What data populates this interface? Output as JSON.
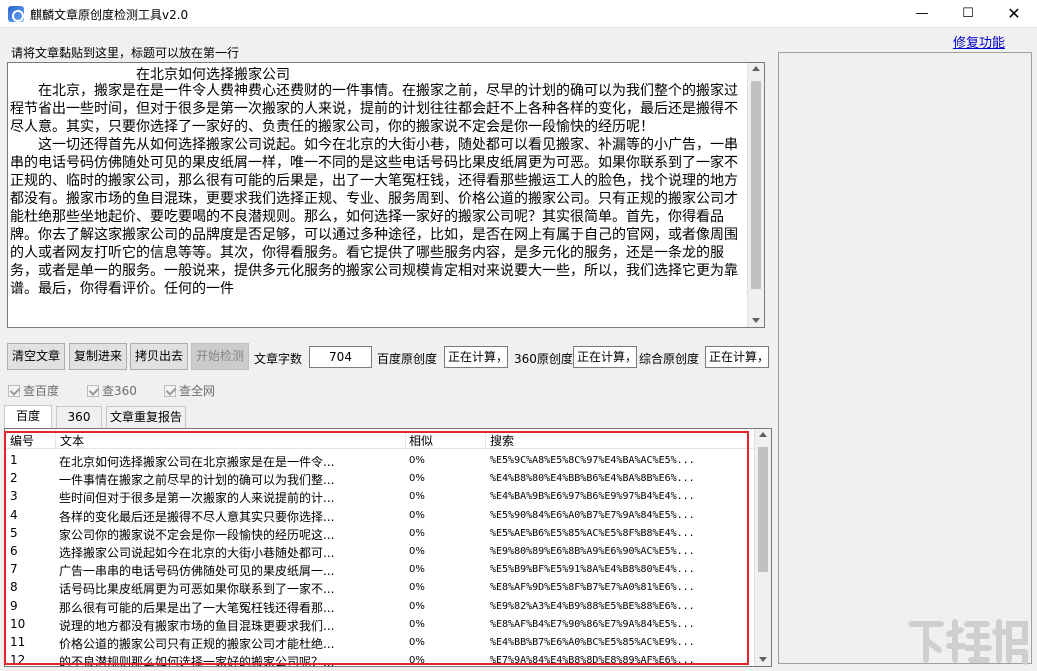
{
  "window": {
    "title": "麒麟文章原创度检测工具v2.0",
    "minimize": "—",
    "maximize": "☐",
    "close": "✕"
  },
  "header": {
    "repair_link": "修复功能"
  },
  "prompt": "请将文章黏贴到这里，标题可以放在第一行",
  "article": {
    "title": "在北京如何选择搬家公司",
    "body": "　　在北京，搬家是在是一件令人费神费心还费财的一件事情。在搬家之前，尽早的计划的确可以为我们整个的搬家过程节省出一些时间，但对于很多是第一次搬家的人来说，提前的计划往往都会赶不上各种各样的变化，最后还是搬得不尽人意。其实，只要你选择了一家好的、负责任的搬家公司，你的搬家说不定会是你一段愉快的经历呢！\n　　这一切还得首先从如何选择搬家公司说起。如今在北京的大街小巷，随处都可以看见搬家、补漏等的小广告，一串串的电话号码仿佛随处可见的果皮纸屑一样，唯一不同的是这些电话号码比果皮纸屑更为可恶。如果你联系到了一家不正规的、临时的搬家公司，那么很有可能的后果是，出了一大笔冤枉钱，还得看那些搬运工人的脸色，找个说理的地方都没有。搬家市场的鱼目混珠，更要求我们选择正规、专业、服务周到、价格公道的搬家公司。只有正规的搬家公司才能杜绝那些坐地起价、要吃要喝的不良潜规则。那么，如何选择一家好的搬家公司呢？其实很简单。首先，你得看品牌。你去了解这家搬家公司的品牌度是否足够，可以通过多种途径，比如，是否在网上有属于自己的官网，或者像周围的人或者网友打听它的信息等等。其次，你得看服务。看它提供了哪些服务内容，是多元化的服务，还是一条龙的服务，或者是单一的服务。一般说来，提供多元化服务的搬家公司规模肯定相对来说要大一些，所以，我们选择它更为靠谱。最后，你得看评价。任何的一件"
  },
  "controls": {
    "clear_btn": "清空文章",
    "paste_btn": "复制进来",
    "copy_out_btn": "拷贝出去",
    "start_btn": "开始检测",
    "word_count_label": "文章字数",
    "word_count_value": "704",
    "baidu_label": "百度原创度",
    "baidu_value": "正在计算，请",
    "s360_label": "360原创度",
    "s360_value": "正在计算，请",
    "overall_label": "综合原创度",
    "overall_value": "正在计算，请"
  },
  "checkboxes": {
    "baidu": "查百度",
    "s360": "查360",
    "all": "查全网"
  },
  "tabs": [
    "百度",
    "360",
    "文章重复报告"
  ],
  "table": {
    "headers": [
      "编号",
      "文本",
      "相似",
      "搜索"
    ],
    "rows": [
      [
        "1",
        "在北京如何选择搬家公司在北京搬家是在是一件令...",
        "0%",
        "%E5%9C%A8%E5%8C%97%E4%BA%AC%E5%..."
      ],
      [
        "2",
        "一件事情在搬家之前尽早的计划的确可以为我们整...",
        "0%",
        "%E4%B8%80%E4%BB%B6%E4%BA%8B%E6%..."
      ],
      [
        "3",
        "些时间但对于很多是第一次搬家的人来说提前的计...",
        "0%",
        "%E4%BA%9B%E6%97%B6%E9%97%B4%E4%..."
      ],
      [
        "4",
        "各样的变化最后还是搬得不尽人意其实只要你选择...",
        "0%",
        "%E5%90%84%E6%A0%B7%E7%9A%84%E5%..."
      ],
      [
        "5",
        "家公司你的搬家说不定会是你一段愉快的经历呢这...",
        "0%",
        "%E5%AE%B6%E5%85%AC%E5%8F%B8%E4%..."
      ],
      [
        "6",
        "选择搬家公司说起如今在北京的大街小巷随处都可...",
        "0%",
        "%E9%80%89%E6%8B%A9%E6%90%AC%E5%..."
      ],
      [
        "7",
        "广告一串串的电话号码仿佛随处可见的果皮纸屑一...",
        "0%",
        "%E5%B9%BF%E5%91%8A%E4%B8%80%E4%..."
      ],
      [
        "8",
        "话号码比果皮纸屑更为可恶如果你联系到了一家不...",
        "0%",
        "%E8%AF%9D%E5%8F%B7%E7%A0%81%E6%..."
      ],
      [
        "9",
        "那么很有可能的后果是出了一大笔冤枉钱还得看那...",
        "0%",
        "%E9%82%A3%E4%B9%88%E5%BE%88%E6%..."
      ],
      [
        "10",
        "说理的地方都没有搬家市场的鱼目混珠更要求我们...",
        "0%",
        "%E8%AF%B4%E7%90%86%E7%9A%84%E5%..."
      ],
      [
        "11",
        "价格公道的搬家公司只有正规的搬家公司才能杜绝...",
        "0%",
        "%E4%BB%B7%E6%A0%BC%E5%85%AC%E9%..."
      ],
      [
        "12",
        "的不良潜规则那么如何选择一家好的搬家公司呢？...",
        "0%",
        "%E7%9A%84%E4%B8%8D%E8%89%AF%E6%..."
      ]
    ]
  },
  "watermark": "下载吧"
}
